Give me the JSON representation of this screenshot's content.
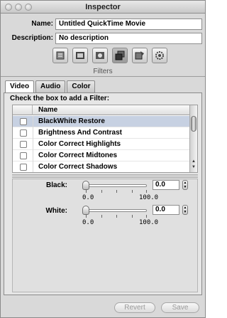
{
  "window": {
    "title": "Inspector"
  },
  "fields": {
    "name_label": "Name:",
    "name_value": "Untitled QuickTime Movie",
    "description_label": "Description:",
    "description_value": "No description"
  },
  "toolbar": {
    "label": "Filters",
    "icons": [
      "summary-icon",
      "video-settings-icon",
      "audio-icon",
      "filters-icon",
      "actions-icon",
      "settings-gear-icon"
    ],
    "selected_index": 3
  },
  "tabs": [
    {
      "label": "Video",
      "active": true
    },
    {
      "label": "Audio",
      "active": false
    },
    {
      "label": "Color",
      "active": false
    }
  ],
  "filters": {
    "hint": "Check the box to add a Filter:",
    "column_name": "Name",
    "rows": [
      {
        "name": "BlackWhite Restore",
        "checked": false,
        "selected": true
      },
      {
        "name": "Brightness And Contrast",
        "checked": false,
        "selected": false
      },
      {
        "name": "Color Correct Highlights",
        "checked": false,
        "selected": false
      },
      {
        "name": "Color Correct Midtones",
        "checked": false,
        "selected": false
      },
      {
        "name": "Color Correct Shadows",
        "checked": false,
        "selected": false
      }
    ]
  },
  "params": {
    "black": {
      "label": "Black:",
      "value": "0.0",
      "min_label": "0.0",
      "max_label": "100.0",
      "level": 0
    },
    "white": {
      "label": "White:",
      "value": "0.0",
      "min_label": "0.0",
      "max_label": "100.0",
      "level": 0
    }
  },
  "buttons": {
    "revert": "Revert",
    "save": "Save"
  },
  "colors": {
    "selection": "#c7d1e2",
    "window_bg": "#d9d9d9"
  }
}
